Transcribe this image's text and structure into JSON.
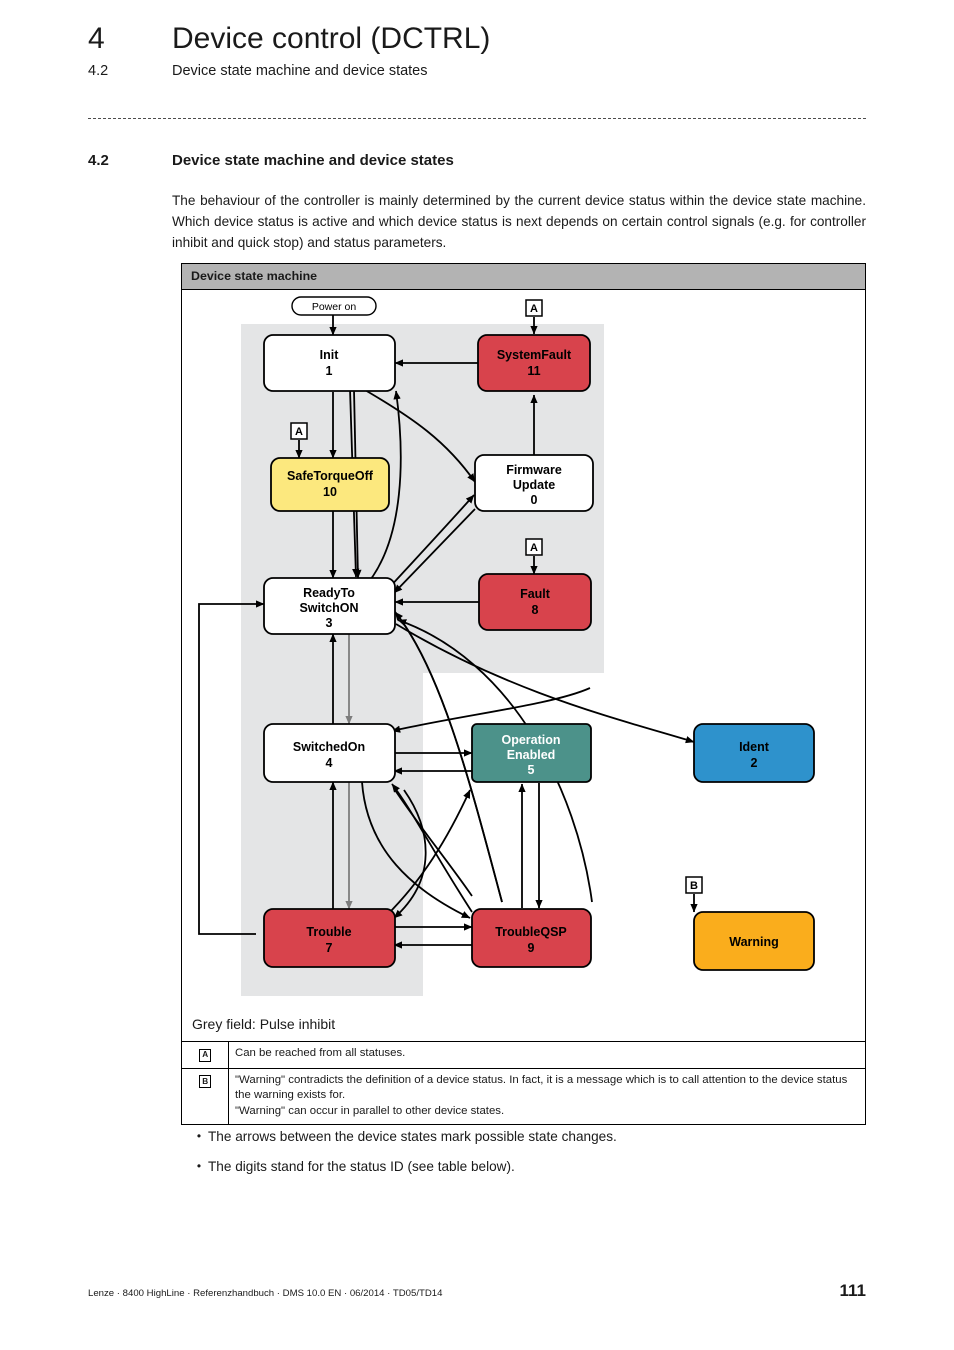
{
  "running_head": {
    "chapter_number": "4",
    "chapter_title": "Device control (DCTRL)",
    "section_number": "4.2",
    "section_title": "Device state machine and device states"
  },
  "section": {
    "number": "4.2",
    "title": "Device state machine and device states",
    "intro": "The behaviour of the controller is mainly determined by the current device status within the device state machine. Which device status is active and which device status is next depends on certain control signals (e.g. for controller inhibit and quick stop) and status parameters."
  },
  "figure": {
    "title": "Device state machine",
    "grey_field_caption": "Grey field: Pulse inhibit",
    "start_label": "Power on",
    "markers": {
      "a": "A",
      "b": "B"
    },
    "notes": [
      {
        "key": "A",
        "text": "Can be reached from all statuses."
      },
      {
        "key": "B",
        "text": "\"Warning\" contradicts the definition of a device status. In fact, it is a message which is to call attention to the device status the warning exists for.\n\"Warning\" can occur in parallel to other device states."
      }
    ],
    "states": [
      {
        "id": "init",
        "name": "Init",
        "status_id": "1",
        "fill": "#ffffff",
        "text_color": "#000000"
      },
      {
        "id": "systemfault",
        "name": "SystemFault",
        "status_id": "11",
        "fill": "#d8434c",
        "text_color": "#000000"
      },
      {
        "id": "safetorqueoff",
        "name": "SafeTorqueOff",
        "status_id": "10",
        "fill": "#fce87e",
        "text_color": "#000000"
      },
      {
        "id": "firmwareupdate",
        "name": "Firmware Update",
        "status_id": "0",
        "fill": "#ffffff",
        "text_color": "#000000"
      },
      {
        "id": "readytoswitchon",
        "name": "ReadyTo SwitchON",
        "status_id": "3",
        "fill": "#ffffff",
        "text_color": "#000000"
      },
      {
        "id": "fault",
        "name": "Fault",
        "status_id": "8",
        "fill": "#d8434c",
        "text_color": "#000000"
      },
      {
        "id": "switchedon",
        "name": "SwitchedOn",
        "status_id": "4",
        "fill": "#ffffff",
        "text_color": "#000000"
      },
      {
        "id": "operationenabled",
        "name": "Operation Enabled",
        "status_id": "5",
        "fill": "#4c928a",
        "text_color": "#ffffff"
      },
      {
        "id": "ident",
        "name": "Ident",
        "status_id": "2",
        "fill": "#2e92cc",
        "text_color": "#000000"
      },
      {
        "id": "trouble",
        "name": "Trouble",
        "status_id": "7",
        "fill": "#d8434c",
        "text_color": "#000000"
      },
      {
        "id": "troubleqsp",
        "name": "TroubleQSP",
        "status_id": "9",
        "fill": "#d8434c",
        "text_color": "#000000"
      },
      {
        "id": "warning",
        "name": "Warning",
        "status_id": "",
        "fill": "#faad1c",
        "text_color": "#000000"
      }
    ],
    "state_labels": {
      "init_l1": "Init",
      "init_l2": "1",
      "systemfault_l1": "SystemFault",
      "systemfault_l2": "11",
      "safetorqueoff_l1": "SafeTorqueOff",
      "safetorqueoff_l2": "10",
      "firmware_l1": "Firmware",
      "firmware_l2": "Update",
      "firmware_l3": "0",
      "ready_l1": "ReadyTo",
      "ready_l2": "SwitchON",
      "ready_l3": "3",
      "fault_l1": "Fault",
      "fault_l2": "8",
      "switchedon_l1": "SwitchedOn",
      "switchedon_l2": "4",
      "operation_l1": "Operation",
      "operation_l2": "Enabled",
      "operation_l3": "5",
      "ident_l1": "Ident",
      "ident_l2": "2",
      "trouble_l1": "Trouble",
      "trouble_l2": "7",
      "troubleqsp_l1": "TroubleQSP",
      "troubleqsp_l2": "9",
      "warning_l1": "Warning"
    },
    "colors": {
      "grey_field": "#e4e5e6",
      "title_bar": "#b3b3b3",
      "red": "#d8434c",
      "yellow": "#fce87e",
      "teal": "#4c928a",
      "blue": "#2e92cc",
      "orange": "#faad1c",
      "stroke": "#000000"
    }
  },
  "bullets": [
    "The arrows between the device states mark possible state changes.",
    "The digits stand for the status ID (see table below)."
  ],
  "footer": {
    "left": "Lenze · 8400 HighLine · Referenzhandbuch · DMS 10.0 EN · 06/2014 · TD05/TD14",
    "page": "111"
  }
}
